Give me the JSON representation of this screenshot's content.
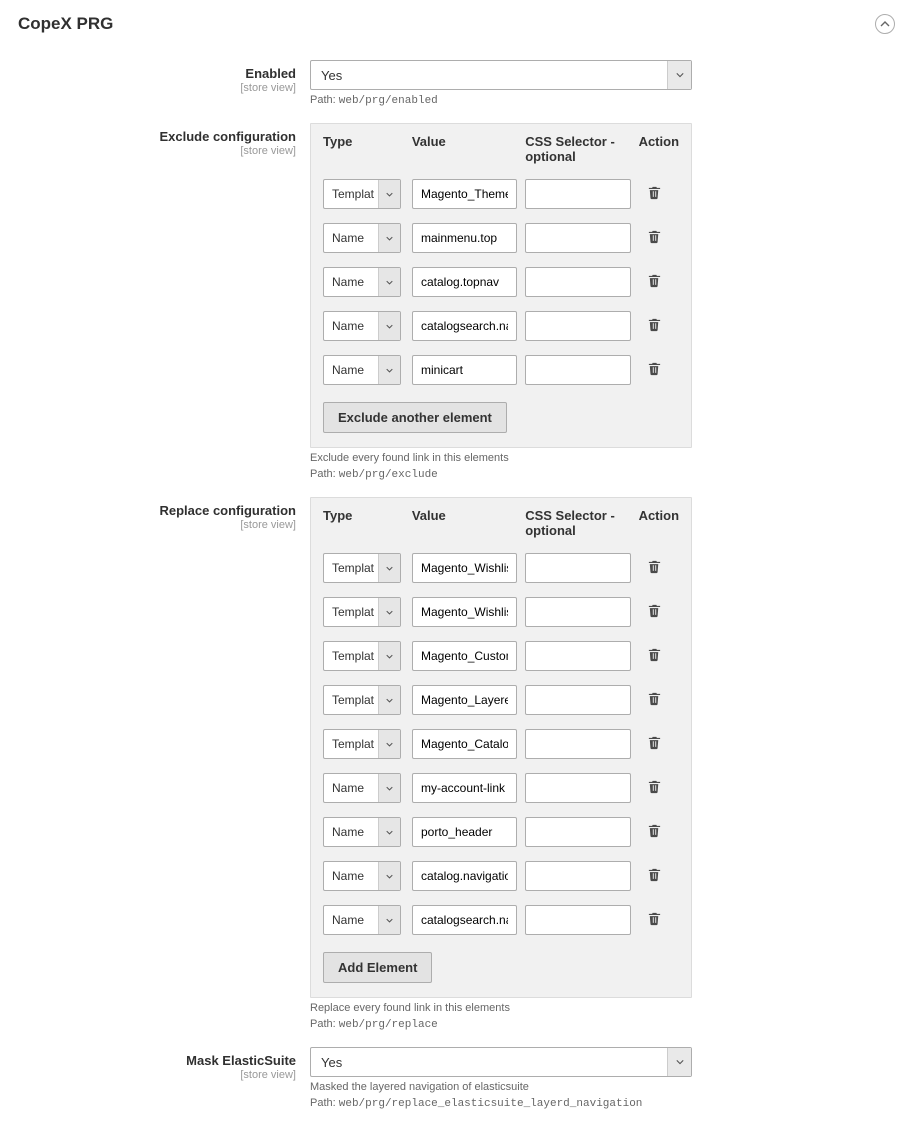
{
  "header": {
    "title": "CopeX PRG"
  },
  "scope_label": "[store view]",
  "path_prefix": "Path: ",
  "enabled": {
    "label": "Enabled",
    "value": "Yes",
    "path": "web/prg/enabled"
  },
  "exclude": {
    "label": "Exclude configuration",
    "headers": {
      "type": "Type",
      "value": "Value",
      "css": "CSS Selector - optional",
      "action": "Action"
    },
    "rows": [
      {
        "type": "Template",
        "value": "Magento_Theme::",
        "css": ""
      },
      {
        "type": "Name",
        "value": "mainmenu.top",
        "css": ""
      },
      {
        "type": "Name",
        "value": "catalog.topnav",
        "css": ""
      },
      {
        "type": "Name",
        "value": "catalogsearch.nav",
        "css": ""
      },
      {
        "type": "Name",
        "value": "minicart",
        "css": ""
      }
    ],
    "add_button": "Exclude another element",
    "hint": "Exclude every found link in this elements",
    "path": "web/prg/exclude"
  },
  "replace": {
    "label": "Replace configuration",
    "headers": {
      "type": "Type",
      "value": "Value",
      "css": "CSS Selector - optional",
      "action": "Action"
    },
    "rows": [
      {
        "type": "Template",
        "value": "Magento_Wishlist:",
        "css": ""
      },
      {
        "type": "Template",
        "value": "Magento_Wishlist:",
        "css": ""
      },
      {
        "type": "Template",
        "value": "Magento_Custome",
        "css": ""
      },
      {
        "type": "Template",
        "value": "Magento_Layered",
        "css": ""
      },
      {
        "type": "Template",
        "value": "Magento_Catalog:",
        "css": ""
      },
      {
        "type": "Name",
        "value": "my-account-link",
        "css": ""
      },
      {
        "type": "Name",
        "value": "porto_header",
        "css": ""
      },
      {
        "type": "Name",
        "value": "catalog.navigation",
        "css": ""
      },
      {
        "type": "Name",
        "value": "catalogsearch.nav",
        "css": ""
      }
    ],
    "add_button": "Add Element",
    "hint": "Replace every found link in this elements",
    "path": "web/prg/replace"
  },
  "mask": {
    "label": "Mask ElasticSuite",
    "value": "Yes",
    "hint": "Masked the layered navigation of elasticsuite",
    "path": "web/prg/replace_elasticsuite_layerd_navigation"
  }
}
